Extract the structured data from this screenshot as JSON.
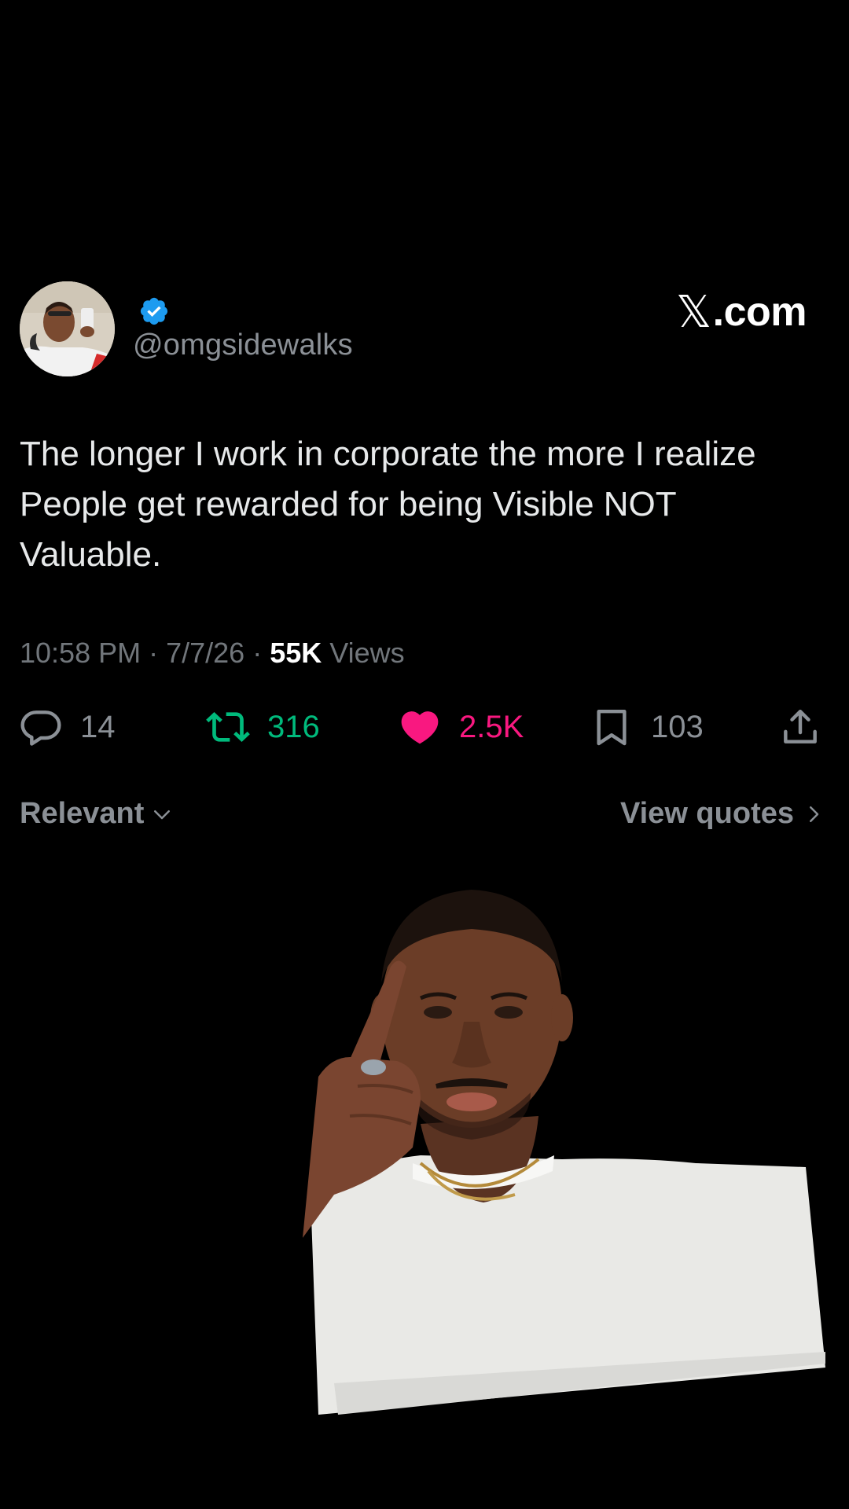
{
  "author": {
    "handle": "@omgsidewalks",
    "verified": true
  },
  "brand": {
    "logo_glyph": "𝕏",
    "label": ".com"
  },
  "tweet": {
    "lines": [
      "The longer I work in corporate the more I realize",
      "People get rewarded for being Visible NOT",
      "Valuable."
    ]
  },
  "meta": {
    "time": "10:58 PM",
    "separator": " · ",
    "date": "7/7/26",
    "views_count": "55K",
    "views_label": " Views"
  },
  "actions": {
    "replies": "14",
    "reposts": "316",
    "likes": "2.5K",
    "bookmarks": "103"
  },
  "filters": {
    "sort_label": "Relevant",
    "view_quotes_label": "View quotes"
  },
  "colors": {
    "background": "#000000",
    "text": "#e7e9ea",
    "muted": "#71767b",
    "verified": "#1d9bf0",
    "repost": "#00ba7c",
    "like": "#f91880"
  }
}
